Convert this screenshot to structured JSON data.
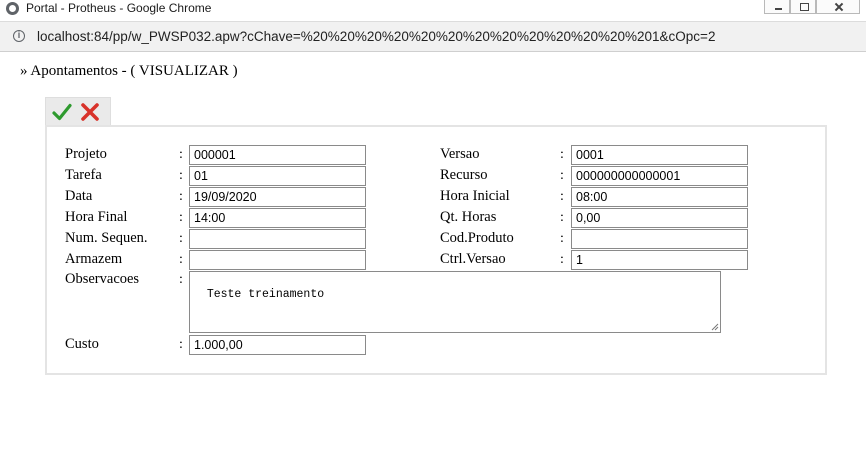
{
  "window": {
    "title": "Portal - Protheus - Google Chrome",
    "url": "localhost:84/pp/w_PWSP032.apw?cChave=%20%20%20%20%20%20%20%20%20%20%20%20%201&cOpc=2"
  },
  "page": {
    "heading": "» Apontamentos - ( VISUALIZAR )"
  },
  "toolbar": {
    "confirm_icon": "check-icon",
    "cancel_icon": "close-x-icon",
    "colors": {
      "confirm": "#2e9a2e",
      "cancel": "#d8322a"
    }
  },
  "form": {
    "separator": ":",
    "left": [
      {
        "label": "Projeto",
        "value": "000001"
      },
      {
        "label": "Tarefa",
        "value": "01"
      },
      {
        "label": "Data",
        "value": "19/09/2020"
      },
      {
        "label": "Hora Final",
        "value": "14:00"
      },
      {
        "label": "Num. Sequen.",
        "value": ""
      },
      {
        "label": "Armazem",
        "value": ""
      }
    ],
    "right": [
      {
        "label": "Versao",
        "value": "0001"
      },
      {
        "label": "Recurso",
        "value": "000000000000001"
      },
      {
        "label": "Hora Inicial",
        "value": "08:00"
      },
      {
        "label": "Qt. Horas",
        "value": "0,00"
      },
      {
        "label": "Cod.Produto",
        "value": ""
      },
      {
        "label": "Ctrl.Versao",
        "value": "1"
      }
    ],
    "observacoes": {
      "label": "Observacoes",
      "value": "Teste treinamento"
    },
    "custo": {
      "label": "Custo",
      "value": "1.000,00"
    }
  }
}
